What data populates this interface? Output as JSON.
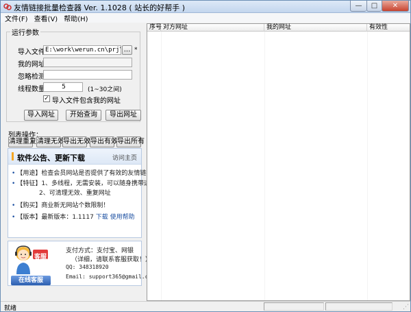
{
  "window": {
    "title": "友情链接批量检查器 Ver. 1.1028 ( 站长的好帮手 )",
    "buttons": {
      "minimize": "—",
      "maximize": "□",
      "close": "✕"
    }
  },
  "menu": [
    "文件(F)",
    "查看(V)",
    "帮助(H)"
  ],
  "params": {
    "legend": "运行参数",
    "import_label": "导入文件：",
    "import_value": "E:\\work\\werun.cn\\prj\\webLinkChk\\",
    "browse_label": "...",
    "star": "*",
    "mysite_label": "我的网址：",
    "mysite_value": "",
    "ignore_label": "忽略检测：",
    "ignore_value": "",
    "threads_label": "线程数量：",
    "threads_value": "5",
    "threads_hint": "(1~30之间)",
    "include_checked": true,
    "include_label": "导入文件包含我的网址"
  },
  "actions": {
    "import": "导入网址",
    "start": "开始查询",
    "export": "导出网址"
  },
  "list_ops": {
    "label": "列表操作：",
    "buttons": [
      "清理重复",
      "清理无效",
      "导出无效",
      "导出有效",
      "导出所有"
    ]
  },
  "notice": {
    "title": "软件公告、更新下载",
    "link": "访问主页",
    "items": [
      {
        "prefix": "【用途】",
        "text": "检查会员网站是否提供了有效的友情链接"
      },
      {
        "prefix": "【特征】",
        "text": "1、多线程，无需安装，可以随身携带运行"
      },
      {
        "prefix": "",
        "text": "2、可清理无效、重复网址"
      },
      {
        "prefix": "【购买】",
        "text": "商业新无网站个数限制！"
      },
      {
        "prefix": "【版本】",
        "text": "最新版本：1.1117 ",
        "link1": "下载",
        "link2": "使用帮助"
      }
    ]
  },
  "support": {
    "badge": "客服",
    "online_button": "在线客服",
    "pay": "支付方式：支付宝、网银",
    "contact": "（详细，请联系客服获取！）",
    "qq": "QQ: 348318920",
    "email": "Email: support365@gmail.com"
  },
  "table": {
    "columns": [
      "序号",
      "对方网址",
      "我的网址",
      "有效性"
    ]
  },
  "status": {
    "text": "就绪"
  }
}
